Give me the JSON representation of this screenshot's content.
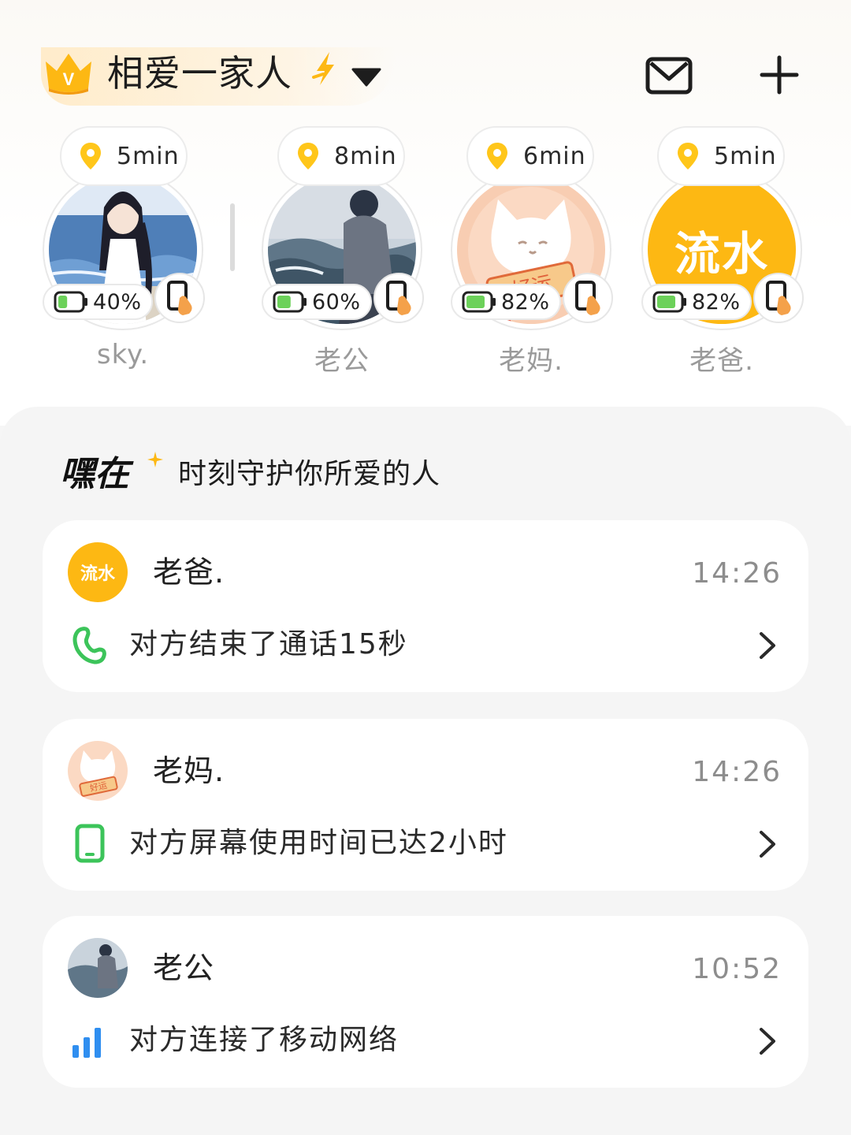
{
  "header": {
    "group_name": "相爱一家人",
    "crown_badge": "V",
    "icons": {
      "crown": "crown-icon",
      "spark": "spark-icon",
      "caret": "caret-down-icon",
      "mail": "mail-icon",
      "add": "plus-icon"
    }
  },
  "members": [
    {
      "name": "sky.",
      "minutes": "5min",
      "battery": "40%",
      "battery_level": 0.4,
      "avatar": "anime-girl-beach-avatar"
    },
    {
      "name": "老公",
      "minutes": "8min",
      "battery": "60%",
      "battery_level": 0.6,
      "avatar": "boy-sitting-by-sea-avatar"
    },
    {
      "name": "老妈.",
      "minutes": "6min",
      "battery": "82%",
      "battery_level": 0.82,
      "avatar": "white-cat-good-luck-avatar",
      "avatar_text": "好运"
    },
    {
      "name": "老爸.",
      "minutes": "5min",
      "battery": "82%",
      "battery_level": 0.82,
      "avatar": "liushui-text-avatar",
      "avatar_text": "流水"
    }
  ],
  "feed": {
    "brand": "嘿在",
    "slogan": "时刻守护你所爱的人",
    "cards": [
      {
        "name": "老爸.",
        "time": "14:26",
        "message": "对方结束了通话15秒",
        "icon": "phone-call-icon",
        "avatar_text": "流水"
      },
      {
        "name": "老妈.",
        "time": "14:26",
        "message": "对方屏幕使用时间已达2小时",
        "icon": "mobile-screen-icon",
        "avatar_text": "好运"
      },
      {
        "name": "老公",
        "time": "10:52",
        "message": "对方连接了移动网络",
        "icon": "signal-bars-icon"
      }
    ]
  },
  "colors": {
    "accent_yellow": "#fdb813",
    "pin_yellow": "#ffc61a",
    "battery_green": "#6cd15a",
    "phone_orange": "#f4a14a",
    "call_green": "#3cc45a",
    "signal_blue": "#2f8ef0"
  }
}
